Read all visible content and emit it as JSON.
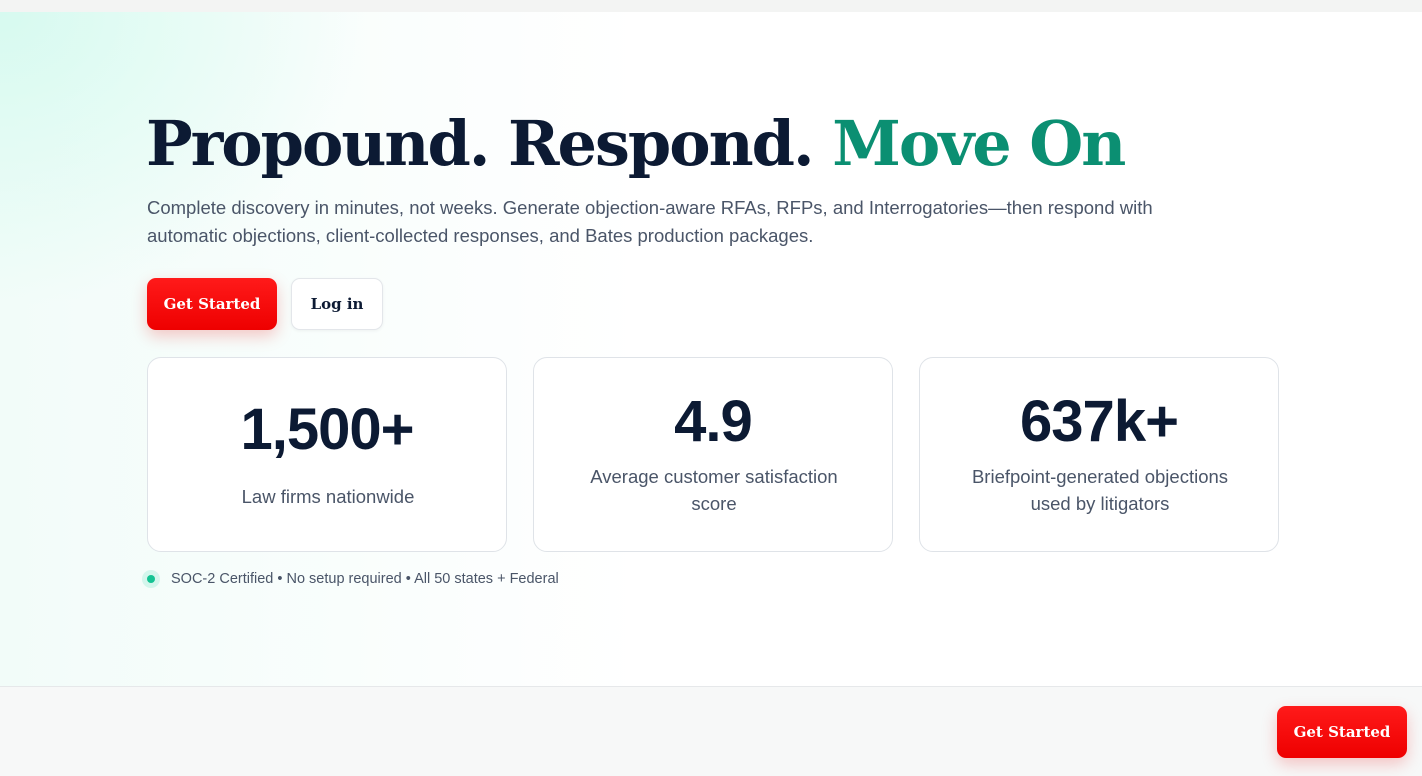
{
  "hero": {
    "headline_part1": "Propound. Respond.",
    "headline_accent": "Move On",
    "subtitle": "Complete discovery in minutes, not weeks. Generate objection-aware RFAs, RFPs, and Interrogatories—then respond with automatic objections, client-collected responses, and Bates production packages.",
    "primary_cta": "Get Started",
    "secondary_cta": "Log in"
  },
  "stats": [
    {
      "value": "1,500+",
      "label": "Law firms nationwide"
    },
    {
      "value": "4.9",
      "label": "Average customer satisfaction score"
    },
    {
      "value": "637k+",
      "label": "Briefpoint-generated objections used by litigators"
    }
  ],
  "trust": {
    "text": "SOC-2 Certified • No setup required • All 50 states + Federal"
  },
  "floating_cta": {
    "label": "Get Started"
  },
  "colors": {
    "accent_green": "#0b8f72",
    "cta_red": "#ee0000",
    "heading_navy": "#0c1a33",
    "status_dot": "#14c393"
  }
}
